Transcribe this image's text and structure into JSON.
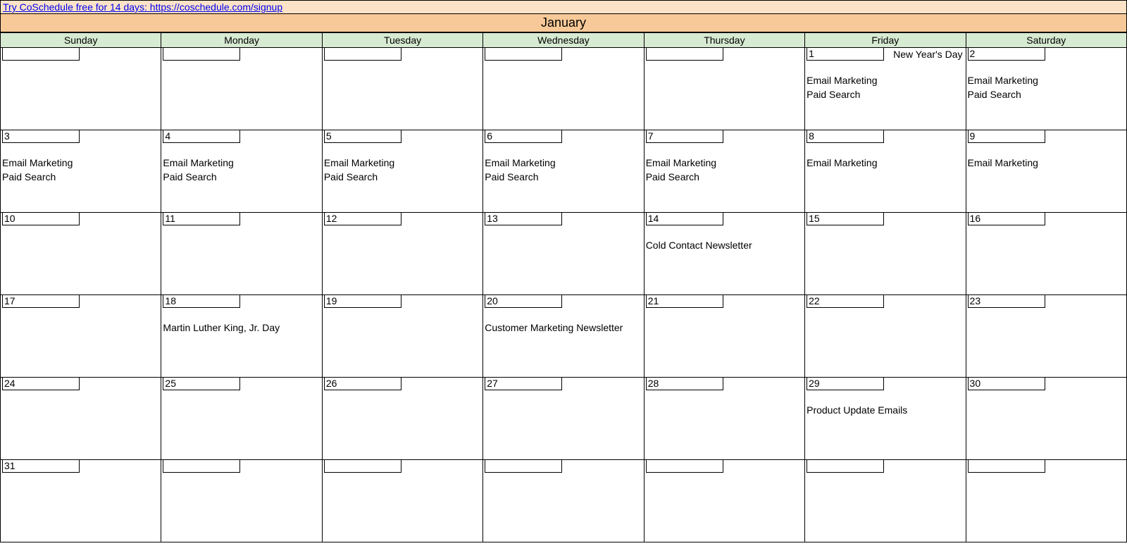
{
  "banner": {
    "link_text": "Try CoSchedule free for 14 days: https://coschedule.com/signup"
  },
  "month": "January",
  "day_names": [
    "Sunday",
    "Monday",
    "Tuesday",
    "Wednesday",
    "Thursday",
    "Friday",
    "Saturday"
  ],
  "weeks": [
    [
      {
        "date": "",
        "holiday": "",
        "events": []
      },
      {
        "date": "",
        "holiday": "",
        "events": []
      },
      {
        "date": "",
        "holiday": "",
        "events": []
      },
      {
        "date": "",
        "holiday": "",
        "events": []
      },
      {
        "date": "",
        "holiday": "",
        "events": []
      },
      {
        "date": "1",
        "holiday": "New Year's Day",
        "events": [
          "Email Marketing",
          "Paid Search"
        ]
      },
      {
        "date": "2",
        "holiday": "",
        "events": [
          "Email Marketing",
          "Paid Search"
        ]
      }
    ],
    [
      {
        "date": "3",
        "holiday": "",
        "events": [
          "Email Marketing",
          "Paid Search"
        ]
      },
      {
        "date": "4",
        "holiday": "",
        "events": [
          "Email Marketing",
          "Paid Search"
        ]
      },
      {
        "date": "5",
        "holiday": "",
        "events": [
          "Email Marketing",
          "Paid Search"
        ]
      },
      {
        "date": "6",
        "holiday": "",
        "events": [
          "Email Marketing",
          "Paid Search"
        ]
      },
      {
        "date": "7",
        "holiday": "",
        "events": [
          "Email Marketing",
          "Paid Search"
        ]
      },
      {
        "date": "8",
        "holiday": "",
        "events": [
          "Email Marketing"
        ]
      },
      {
        "date": "9",
        "holiday": "",
        "events": [
          "Email Marketing"
        ]
      }
    ],
    [
      {
        "date": "10",
        "holiday": "",
        "events": []
      },
      {
        "date": "11",
        "holiday": "",
        "events": []
      },
      {
        "date": "12",
        "holiday": "",
        "events": []
      },
      {
        "date": "13",
        "holiday": "",
        "events": []
      },
      {
        "date": "14",
        "holiday": "",
        "events": [
          "Cold Contact Newsletter"
        ]
      },
      {
        "date": "15",
        "holiday": "",
        "events": []
      },
      {
        "date": "16",
        "holiday": "",
        "events": []
      }
    ],
    [
      {
        "date": "17",
        "holiday": "",
        "events": []
      },
      {
        "date": "18",
        "holiday": "",
        "events": [
          "Martin Luther King, Jr. Day"
        ]
      },
      {
        "date": "19",
        "holiday": "",
        "events": []
      },
      {
        "date": "20",
        "holiday": "",
        "events": [
          "Customer Marketing Newsletter"
        ]
      },
      {
        "date": "21",
        "holiday": "",
        "events": []
      },
      {
        "date": "22",
        "holiday": "",
        "events": []
      },
      {
        "date": "23",
        "holiday": "",
        "events": []
      }
    ],
    [
      {
        "date": "24",
        "holiday": "",
        "events": []
      },
      {
        "date": "25",
        "holiday": "",
        "events": []
      },
      {
        "date": "26",
        "holiday": "",
        "events": []
      },
      {
        "date": "27",
        "holiday": "",
        "events": []
      },
      {
        "date": "28",
        "holiday": "",
        "events": []
      },
      {
        "date": "29",
        "holiday": "",
        "events": [
          "Product Update Emails"
        ]
      },
      {
        "date": "30",
        "holiday": "",
        "events": []
      }
    ],
    [
      {
        "date": "31",
        "holiday": "",
        "events": []
      },
      {
        "date": "",
        "holiday": "",
        "events": []
      },
      {
        "date": "",
        "holiday": "",
        "events": []
      },
      {
        "date": "",
        "holiday": "",
        "events": []
      },
      {
        "date": "",
        "holiday": "",
        "events": []
      },
      {
        "date": "",
        "holiday": "",
        "events": []
      },
      {
        "date": "",
        "holiday": "",
        "events": []
      }
    ]
  ]
}
